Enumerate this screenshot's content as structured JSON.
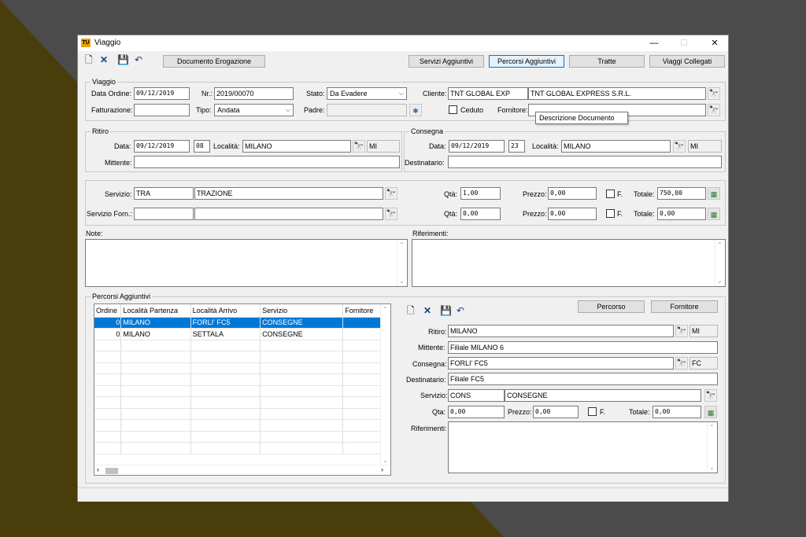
{
  "window": {
    "title": "Viaggio",
    "app_icon": "TU",
    "accent": "#0078d7"
  },
  "toolbar": {
    "doc_erogazione": "Documento Erogazione",
    "servizi_aggiuntivi": "Servizi Aggiuntivi",
    "percorsi_aggiuntivi": "Percorsi Aggiuntivi",
    "tratte": "Tratte",
    "viaggi_collegati": "Viaggi Collegati"
  },
  "viaggio": {
    "group_label": "Viaggio",
    "data_ordine_label": "Data Ordine:",
    "data_ordine": "09/12/2019",
    "nr_label": "Nr.:",
    "nr": "2019/00070",
    "stato_label": "Stato:",
    "stato": "Da Evadere",
    "cliente_label": "Cliente:",
    "cliente_code": "TNT GLOBAL EXP",
    "cliente_name": "TNT GLOBAL EXPRESS S.R.L.",
    "fatturazione_label": "Fatturazione:",
    "fatturazione": "",
    "tipo_label": "Tipo:",
    "tipo": "Andata",
    "padre_label": "Padre:",
    "padre": "",
    "ceduto_label": "Ceduto",
    "fornitore_label": "Fornitore:",
    "fornitore": "",
    "tooltip": "Descrizione Documento"
  },
  "ritiro": {
    "group_label": "Ritiro",
    "data_label": "Data:",
    "data": "09/12/2019",
    "day": "08",
    "localita_label": "Località:",
    "localita": "MILANO",
    "prov": "MI",
    "mittente_label": "Mittente:",
    "mittente": ""
  },
  "consegna": {
    "group_label": "Consegna",
    "data_label": "Data:",
    "data": "09/12/2019",
    "day": "23",
    "localita_label": "Località:",
    "localita": "MILANO",
    "prov": "MI",
    "destinatario_label": "Destinatario:",
    "destinatario": ""
  },
  "servizio": {
    "servizio_label": "Servizio:",
    "code": "TRA",
    "name": "TRAZIONE",
    "qta_label": "Qtà:",
    "qta": "1,00",
    "prezzo_label": "Prezzo:",
    "prezzo": "0,00",
    "f_label": "F.",
    "totale_label": "Totale:",
    "totale": "750,00",
    "forn_label": "Servizio Forn.:",
    "forn_code": "",
    "forn_name": "",
    "forn_qta": "0,00",
    "forn_prezzo": "0,00",
    "forn_totale": "0,00"
  },
  "note": {
    "note_label": "Note:",
    "riferimenti_label": "Riferimenti:"
  },
  "percorsi": {
    "group_label": "Percorsi Aggiuntivi",
    "columns": [
      "Ordine",
      "Località Partenza",
      "Località Arrivo",
      "Servizio",
      "Fornitore"
    ],
    "rows": [
      [
        "0",
        "MILANO",
        "FORLI' FC5",
        "CONSEGNE",
        ""
      ],
      [
        "0",
        "MILANO",
        "SETTALA",
        "CONSEGNE",
        ""
      ]
    ],
    "percorso_btn": "Percorso",
    "fornitore_btn": "Fornitore",
    "ritiro_label": "Ritiro:",
    "ritiro": "MILANO",
    "ritiro_prov": "MI",
    "mittente_label": "Mittente:",
    "mittente": "Filiale MILANO 6",
    "consegna_label": "Consegna:",
    "consegna": "FORLI' FC5",
    "consegna_prov": "FC",
    "destinatario_label": "Destinatario:",
    "destinatario": "Filiale FC5",
    "servizio_label": "Servizio:",
    "servizio_code": "CONS",
    "servizio_name": "CONSEGNE",
    "qta_label": "Qta:",
    "qta": "0,00",
    "prezzo_label": "Prezzo:",
    "prezzo": "0,00",
    "f_label": "F.",
    "totale_label": "Totale:",
    "totale": "0,00",
    "riferimenti_label": "Riferimenti:"
  }
}
